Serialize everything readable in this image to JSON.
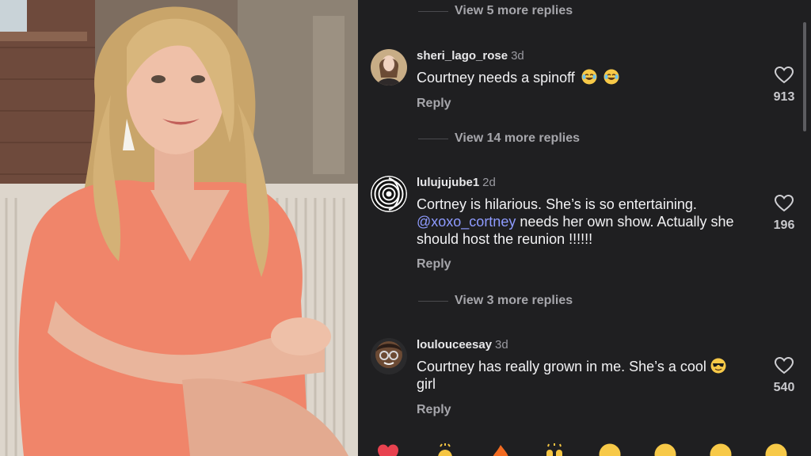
{
  "colors": {
    "panel_bg": "#1f1f21",
    "text_primary": "#f2f2f4",
    "text_secondary": "#a6a6ab",
    "mention": "#8e9bff",
    "outfit": "#f0856a"
  },
  "photo": {
    "description_icon": "video-frame-image"
  },
  "threads": {
    "top_more_replies": "View 5 more replies"
  },
  "comments": [
    {
      "username": "sheri_lago_rose",
      "age": "3d",
      "text": "Courtney needs a spinoff",
      "emoji": [
        "joy-emoji",
        "joy-emoji"
      ],
      "reply_label": "Reply",
      "likes": "913",
      "more_replies": "View 14 more replies",
      "avatar_icon": "profile-photo-icon"
    },
    {
      "username": "lulujujube1",
      "age": "2d",
      "text_part1": "Cortney is hilarious. She’s is so entertaining.",
      "mention": "@xoxo_cortney",
      "text_part2": " needs her own show. Actually she should host the reunion !!!!!!",
      "reply_label": "Reply",
      "likes": "196",
      "more_replies": "View 3 more replies",
      "avatar_icon": "spiral-avatar-icon"
    },
    {
      "username": "loulouceesay",
      "age": "3d",
      "text_part1": "Courtney has really grown in me. She’s a cool",
      "emoji": [
        "sunglasses-emoji"
      ],
      "text_part2": " girl",
      "reply_label": "Reply",
      "likes": "540",
      "avatar_icon": "memoji-avatar-icon"
    }
  ],
  "reaction_bar": [
    "heart-emoji",
    "clap-emoji",
    "fire-emoji",
    "raised-hands-emoji",
    "smile-emoji",
    "grin-emoji",
    "laugh-emoji",
    "wink-emoji"
  ]
}
